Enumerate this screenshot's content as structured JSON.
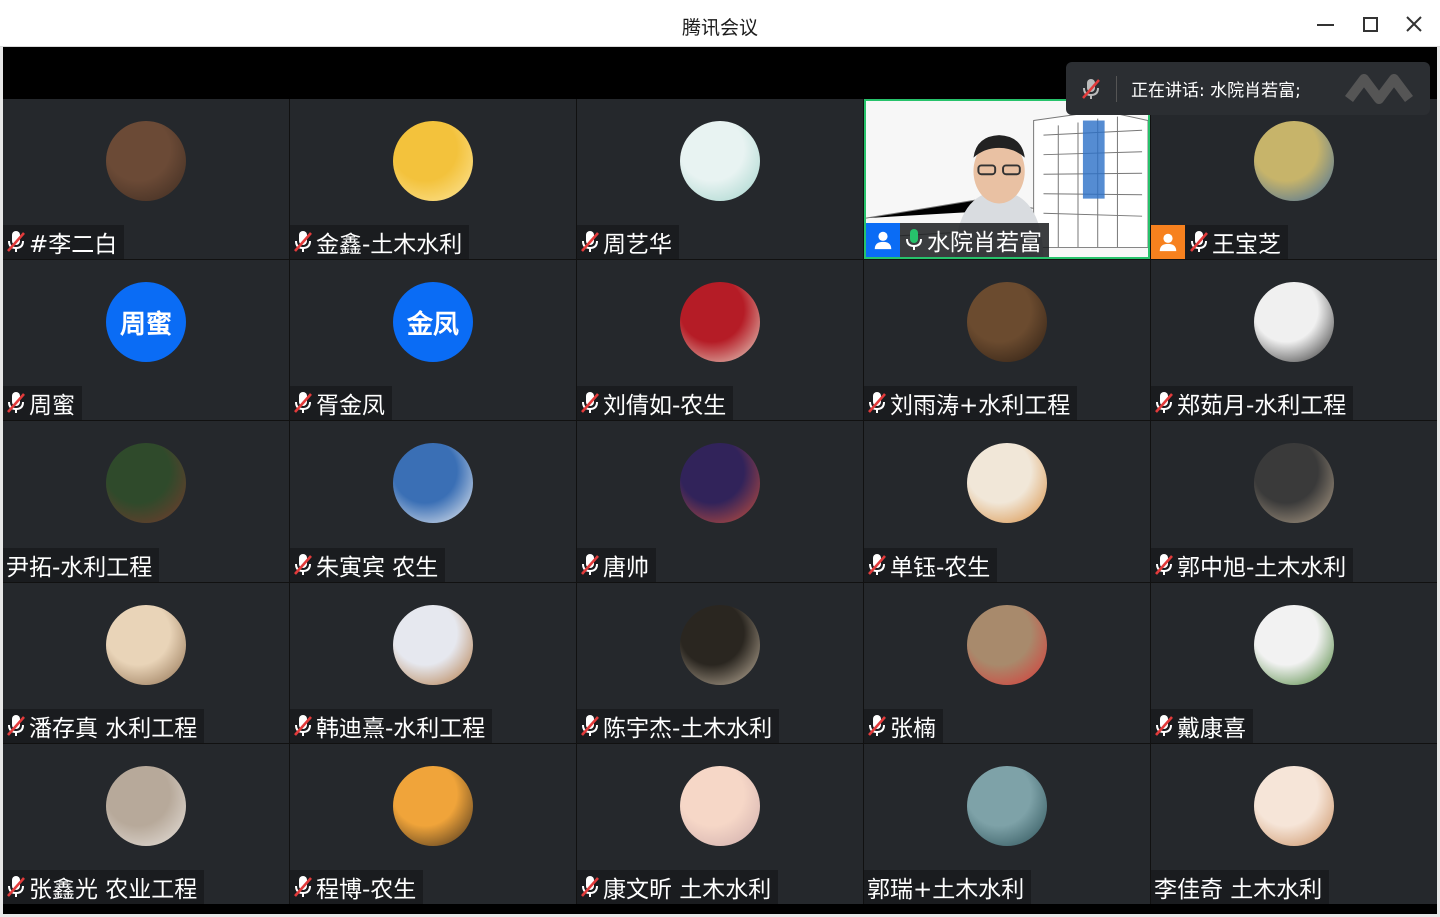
{
  "window": {
    "title": "腾讯会议",
    "controls": [
      "minimize-icon",
      "maximize-icon",
      "close-icon"
    ]
  },
  "speaking_banner": {
    "text": "正在讲话: 水院肖若富;",
    "icon": "mic-muted-icon"
  },
  "colors": {
    "tile_bg": "#25282c",
    "accent_blue": "#0a6cf5",
    "host_orange": "#f7811e",
    "speaking_green": "#27c26b",
    "mic_muted_red": "#e23b3b"
  },
  "participants": [
    {
      "name": "#李二白",
      "mic": "muted",
      "avatar": "photo"
    },
    {
      "name": "金鑫-土木水利",
      "mic": "muted",
      "avatar": "photo"
    },
    {
      "name": "周艺华",
      "mic": "muted",
      "avatar": "photo"
    },
    {
      "name": "水院肖若富",
      "mic": "speaking",
      "avatar": "video",
      "badge": "host-blue"
    },
    {
      "name": "王宝芝",
      "mic": "muted",
      "avatar": "photo",
      "badge": "host-orange"
    },
    {
      "name": "周蜜",
      "mic": "muted",
      "avatar": "text",
      "avatar_text": "周蜜"
    },
    {
      "name": "胥金凤",
      "mic": "muted",
      "avatar": "text",
      "avatar_text": "金凤"
    },
    {
      "name": "刘倩如-农生",
      "mic": "muted",
      "avatar": "photo"
    },
    {
      "name": "刘雨涛+水利工程",
      "mic": "muted",
      "avatar": "photo"
    },
    {
      "name": "郑茹月-水利工程",
      "mic": "muted",
      "avatar": "photo"
    },
    {
      "name": "尹拓-水利工程",
      "mic": "none",
      "avatar": "photo"
    },
    {
      "name": "朱寅宾 农生",
      "mic": "muted",
      "avatar": "photo"
    },
    {
      "name": "唐帅",
      "mic": "muted",
      "avatar": "photo"
    },
    {
      "name": "单钰-农生",
      "mic": "muted",
      "avatar": "photo"
    },
    {
      "name": "郭中旭-土木水利",
      "mic": "muted",
      "avatar": "photo"
    },
    {
      "name": "潘存真 水利工程",
      "mic": "muted",
      "avatar": "photo"
    },
    {
      "name": "韩迪熹-水利工程",
      "mic": "muted",
      "avatar": "photo"
    },
    {
      "name": "陈宇杰-土木水利",
      "mic": "muted",
      "avatar": "photo"
    },
    {
      "name": "张楠",
      "mic": "muted",
      "avatar": "photo"
    },
    {
      "name": "戴康喜",
      "mic": "muted",
      "avatar": "photo"
    },
    {
      "name": "张鑫光 农业工程",
      "mic": "muted",
      "avatar": "photo"
    },
    {
      "name": "程博-农生",
      "mic": "muted",
      "avatar": "photo"
    },
    {
      "name": "康文昕 土木水利",
      "mic": "muted",
      "avatar": "photo"
    },
    {
      "name": "郭瑞+土木水利",
      "mic": "none",
      "avatar": "photo"
    },
    {
      "name": "李佳奇 土木水利",
      "mic": "none",
      "avatar": "photo"
    }
  ]
}
